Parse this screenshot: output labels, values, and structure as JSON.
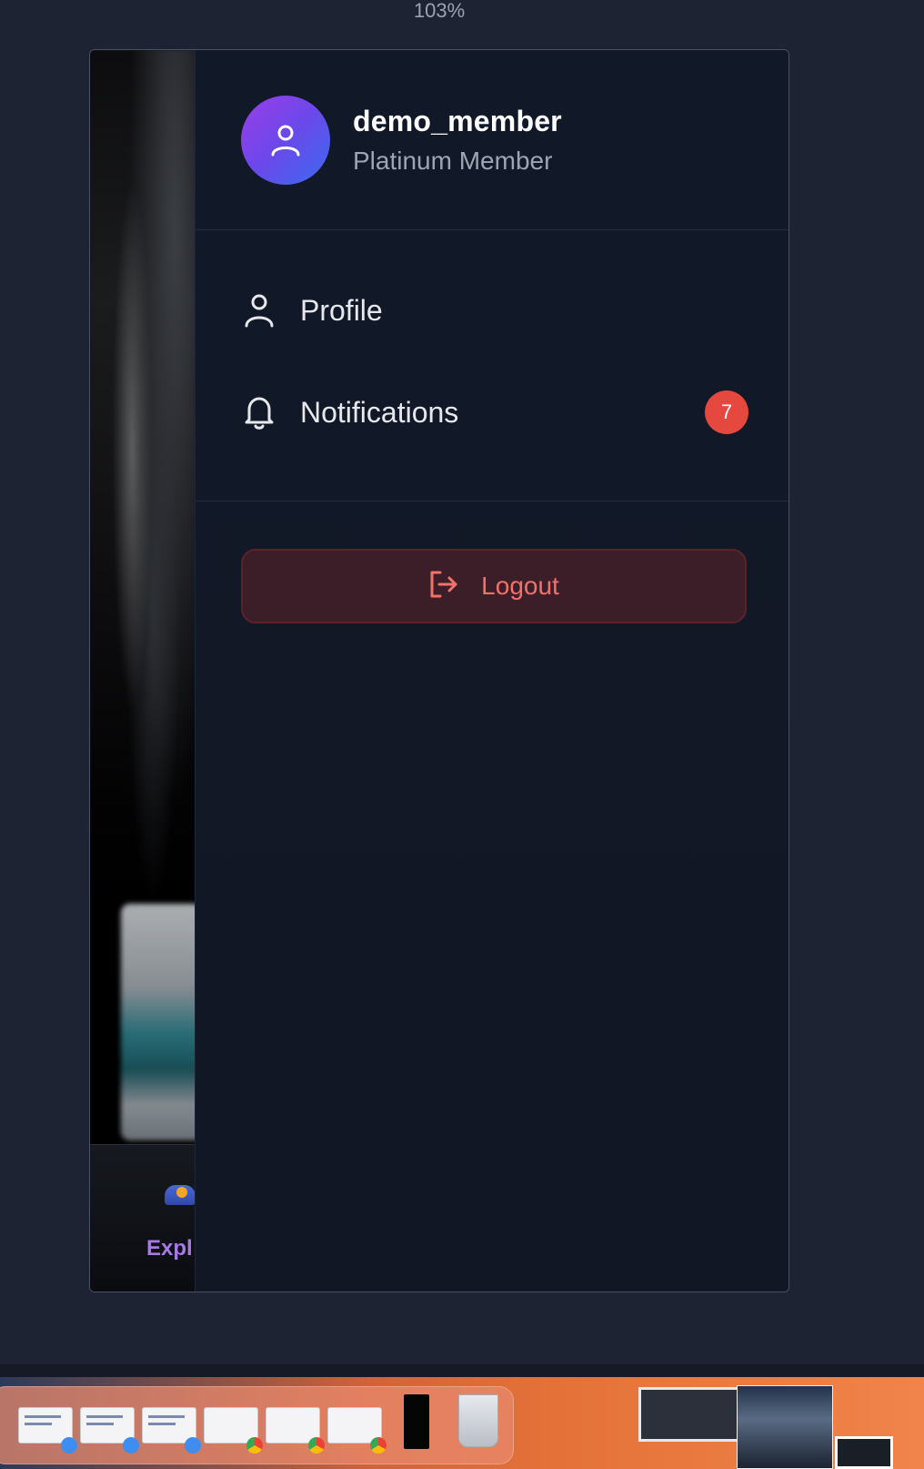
{
  "zoom": {
    "label": "103%"
  },
  "background_app": {
    "explore_label": "Expl"
  },
  "user": {
    "username": "demo_member",
    "tier": "Platinum Member"
  },
  "menu": {
    "items": [
      {
        "label": "Profile",
        "icon": "user-icon"
      },
      {
        "label": "Notifications",
        "icon": "bell-icon",
        "badge": "7"
      }
    ]
  },
  "logout": {
    "label": "Logout",
    "icon": "logout-icon"
  },
  "colors": {
    "page_bg": "#1e2333",
    "drawer_bg": "#111827",
    "avatar_gradient_start": "#9b3ee8",
    "avatar_gradient_end": "#3b6cf0",
    "badge": "#e5483f",
    "logout_text": "#f1726b",
    "logout_bg": "#3b1e27",
    "explore_accent": "#a779e8"
  },
  "dock": {
    "icons": [
      "finder-window-icon",
      "finder-window-icon",
      "finder-window-icon",
      "chrome-window-icon",
      "chrome-window-icon",
      "chrome-window-icon",
      "preview-icon",
      "trash-icon"
    ]
  }
}
